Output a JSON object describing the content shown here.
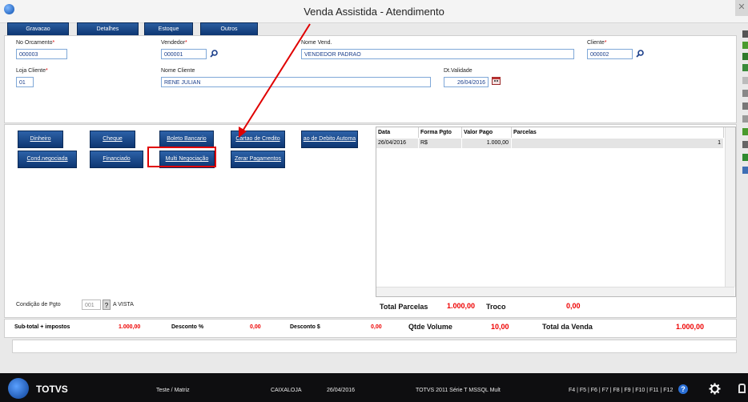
{
  "window": {
    "title": "Venda Assistida - Atendimento",
    "close_glyph": "✕"
  },
  "tabs": [
    "Gravacao",
    "Detalhes",
    "Estoque",
    "Outros"
  ],
  "header": {
    "no_orcamento": {
      "label": "No Orcamento",
      "value": "000003"
    },
    "vendedor": {
      "label": "Vendedor",
      "value": "000001"
    },
    "nome_vend": {
      "label": "Nome Vend.",
      "value": "VENDEDOR PADRAO"
    },
    "cliente": {
      "label": "Cliente",
      "value": "000002"
    },
    "loja_cliente": {
      "label": "Loja Cliente",
      "value": "01"
    },
    "nome_cliente": {
      "label": "Nome Cliente",
      "value": "RENE JULIAN"
    },
    "dt_validade": {
      "label": "Dt.Validade",
      "value": "26/04/2016"
    },
    "required_mark": "*"
  },
  "payment_buttons": [
    "Dinheiro",
    "Cheque",
    "Boleto Bancario",
    "Cartao de Credito",
    "ao de Debito Automa",
    "Cond.negociada",
    "Financiado",
    "Multi Negociação",
    "Zerar Pagamentos"
  ],
  "grid": {
    "columns": [
      "Data",
      "Forma Pgto",
      "Valor Pago",
      "Parcelas"
    ],
    "rows": [
      {
        "data": "26/04/2016",
        "forma": "R$",
        "valor": "1.000,00",
        "parcelas": "1"
      }
    ]
  },
  "condicao": {
    "label": "Condição de Pgto",
    "code": "001",
    "help": "?",
    "desc": "A VISTA"
  },
  "totals": {
    "total_parcelas_label": "Total Parcelas",
    "total_parcelas": "1.000,00",
    "troco_label": "Troco",
    "troco": "0,00"
  },
  "summary": {
    "subtotal_label": "Sub-total + impostos",
    "subtotal": "1.000,00",
    "desconto_pct_label": "Desconto %",
    "desconto_pct": "0,00",
    "desconto_val_label": "Desconto $",
    "desconto_val": "0,00",
    "qtde_label": "Qtde Volume",
    "qtde": "10,00",
    "total_label": "Total da Venda",
    "total": "1.000,00"
  },
  "statusbar": {
    "brand": "TOTVS",
    "env": "Teste / Matriz",
    "user": "CAIXALOJA",
    "date": "26/04/2016",
    "system": "TOTVS 2011 Série T  MSSQL Mult",
    "keys": "F4 | F5 | F6 | F7 | F8 | F9 | F10 | F11 | F12"
  },
  "colors": {
    "accent": "#0d3672",
    "annotation": "#e00000",
    "value_red": "#e00000"
  }
}
